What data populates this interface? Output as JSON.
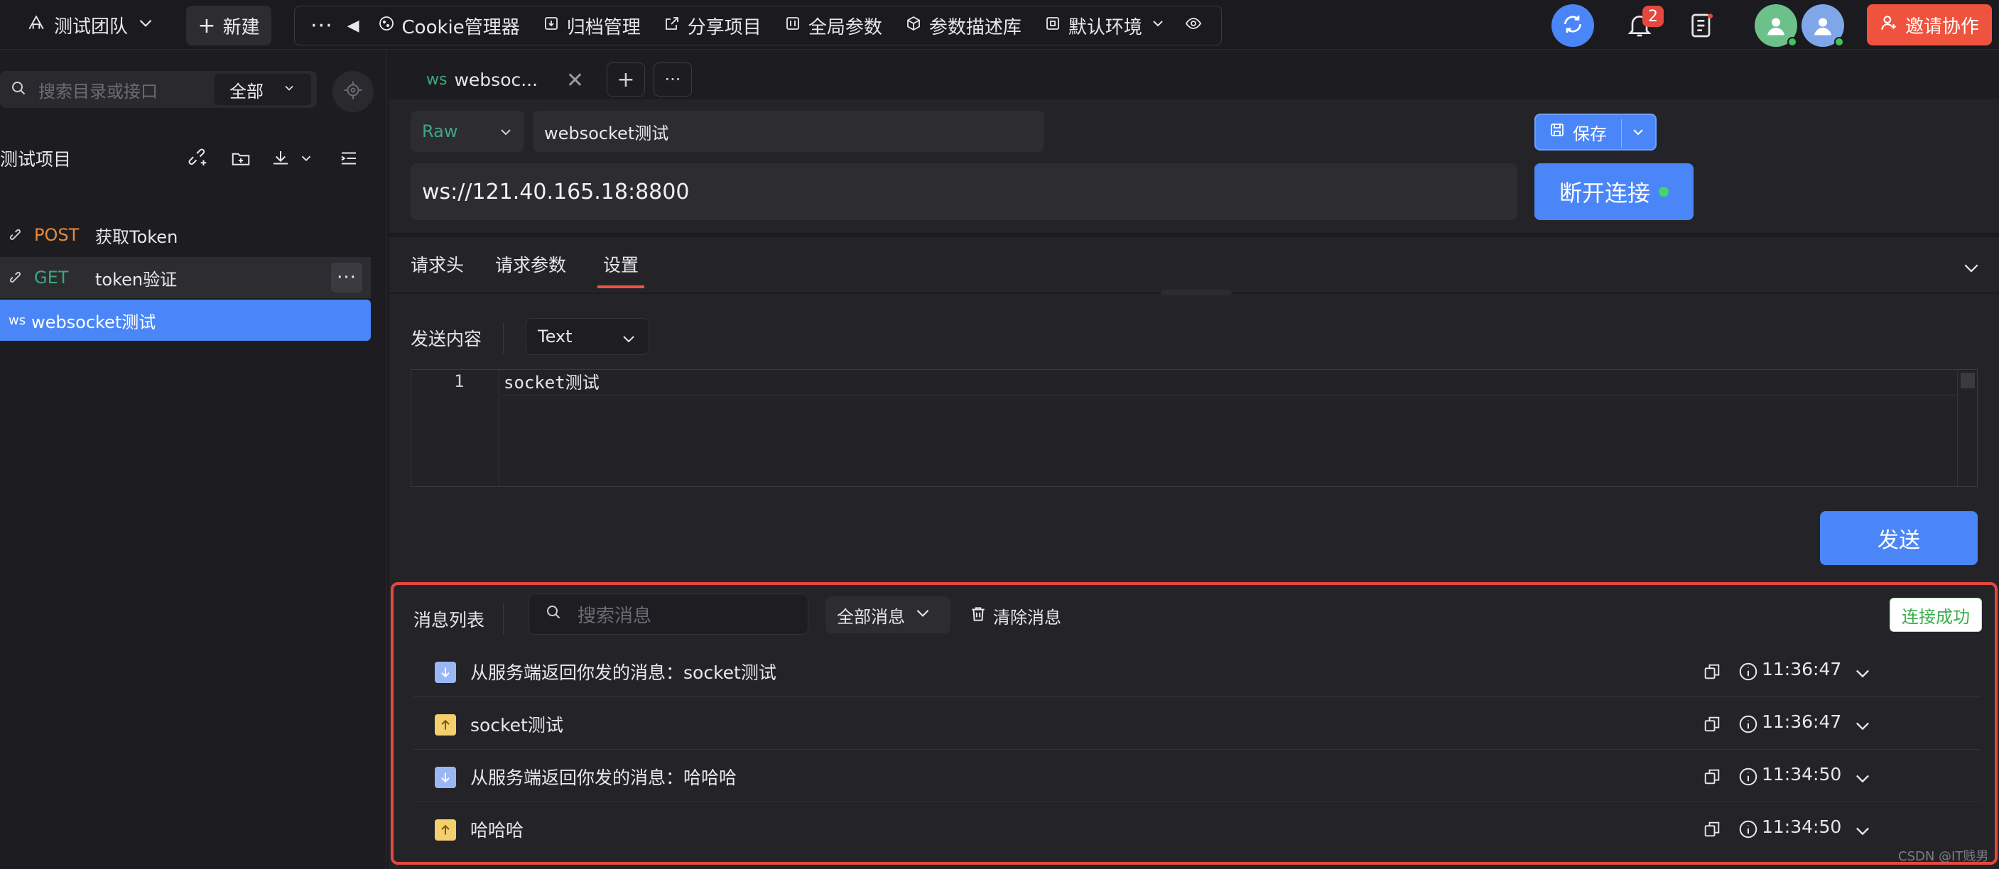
{
  "topbar": {
    "team": "测试团队",
    "new_label": "新建",
    "tools": [
      "Cookie管理器",
      "归档管理",
      "分享项目",
      "全局参数",
      "参数描述库",
      "默认环境"
    ],
    "bell_count": "2",
    "invite_label": "邀请协作"
  },
  "sidebar": {
    "search_placeholder": "搜索目录或接口",
    "scope": "全部",
    "project": "测试项目",
    "apis": [
      {
        "method": "POST",
        "name": "获取Token",
        "method_color": "#e8893a"
      },
      {
        "method": "GET",
        "name": "token验证",
        "method_color": "#3ea77b"
      },
      {
        "method": "ws",
        "name": "websocket测试",
        "method_color": "#ffffff"
      }
    ]
  },
  "tab": {
    "prefix": "ws",
    "title": "websoc..."
  },
  "request": {
    "mode": "Raw",
    "name": "websocket测试",
    "save_label": "保存",
    "url": "ws://121.40.165.18:8800",
    "disconnect_label": "断开连接"
  },
  "subtabs": [
    "请求头",
    "请求参数",
    "设置"
  ],
  "body": {
    "label": "发送内容",
    "format": "Text",
    "line": "1",
    "content": "socket测试",
    "send_label": "发送"
  },
  "messages": {
    "title": "消息列表",
    "search_placeholder": "搜索消息",
    "filter": "全部消息",
    "clear_label": "清除消息",
    "status": "连接成功",
    "items": [
      {
        "dir": "down",
        "text": "从服务端返回你发的消息：socket测试",
        "time": "11:36:47"
      },
      {
        "dir": "up",
        "text": "socket测试",
        "time": "11:36:47"
      },
      {
        "dir": "down",
        "text": "从服务端返回你发的消息：哈哈哈",
        "time": "11:34:50"
      },
      {
        "dir": "up",
        "text": "哈哈哈",
        "time": "11:34:50"
      }
    ]
  },
  "watermark": "CSDN @IT贱男",
  "colors": {
    "accent": "#4a86f7",
    "danger": "#e5483e",
    "success": "#3aad4b"
  }
}
